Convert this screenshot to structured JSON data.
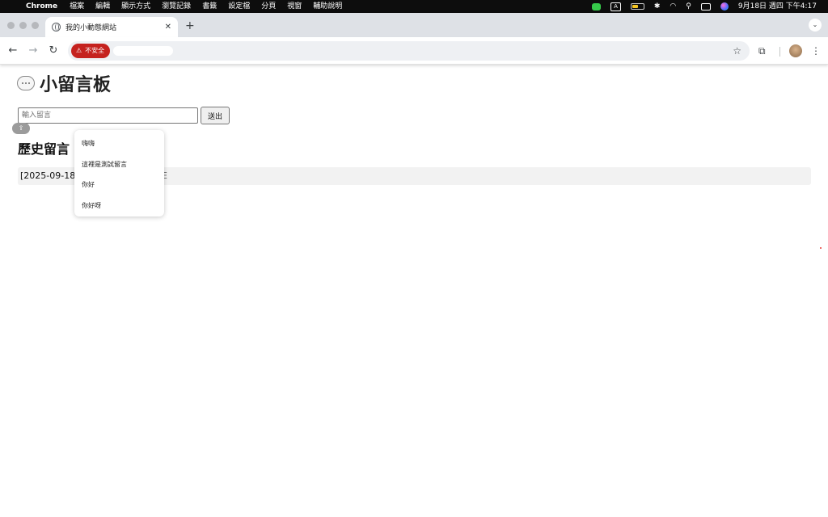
{
  "menubar": {
    "app_name": "Chrome",
    "items": [
      "檔案",
      "編輯",
      "顯示方式",
      "瀏覽記錄",
      "書籤",
      "設定檔",
      "分頁",
      "視窗",
      "輔助說明"
    ],
    "input_indicator": "A",
    "datetime": "9月18日 週四 下午4:17",
    "battery_level": 0.5
  },
  "browser": {
    "tab_title": "我的小動態網站",
    "tab_close": "✕",
    "new_tab": "+",
    "security_label": "不安全"
  },
  "page": {
    "heading": "小留言板",
    "input_placeholder": "輸入留言",
    "input_value": "",
    "send_label": "送出",
    "history_title": "歷史留言",
    "messages": [
      "[2025-09-18 0"
    ],
    "message_tail": "E"
  },
  "autocomplete": {
    "options": [
      "嗨嗨",
      "這裡是測試留言",
      "你好",
      "你好呀"
    ]
  },
  "colors": {
    "insecure_badge": "#c5221f",
    "tabstrip": "#dee1e6",
    "omnibox": "#eef0f3",
    "message_row": "#f2f2f2"
  }
}
